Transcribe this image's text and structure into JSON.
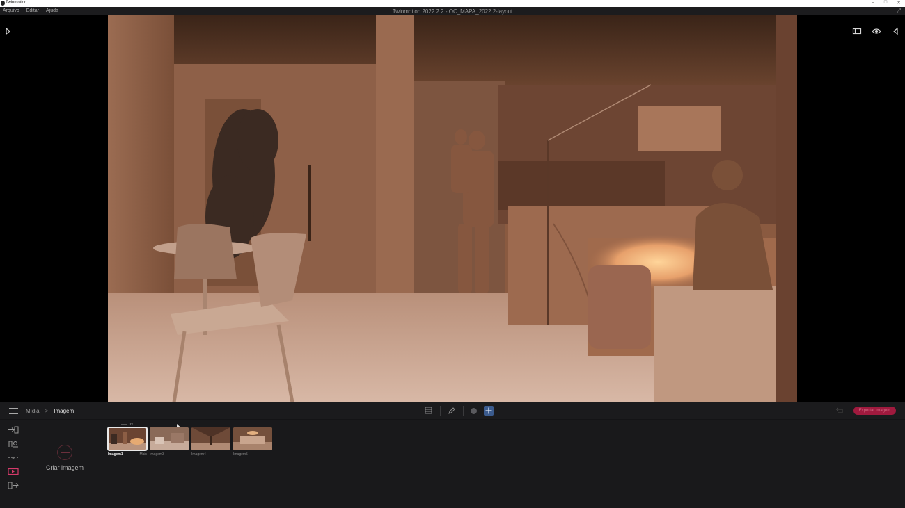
{
  "window": {
    "app_name": "Twinmotion",
    "doc_title": "Twinmotion 2022.2.2 - OC_MAPA_2022.2-layout",
    "controls": [
      "–",
      "□",
      "✕"
    ]
  },
  "menu": [
    "Arquivo",
    "Editar",
    "Ajuda"
  ],
  "breadcrumb": {
    "parent": "Mídia",
    "separator": ">",
    "current": "Imagem"
  },
  "toolbar": {
    "export_label": "Exportar imagem"
  },
  "create_image": {
    "label": "Criar imagem"
  },
  "thumbnails": [
    {
      "name": "Imagem1",
      "selected": true,
      "more": "Mais"
    },
    {
      "name": "Imagem3",
      "selected": false
    },
    {
      "name": "Imagem4",
      "selected": false
    },
    {
      "name": "Imagem5",
      "selected": false
    }
  ],
  "colors": {
    "accent_red": "#a01a3e",
    "move_active": "#3b5b8e",
    "panel_bg": "#19191b"
  },
  "icons": {
    "left_panel_toggle": "play-triangle-icon",
    "top_right": [
      "layout-icon",
      "eye-icon",
      "collapse-left-icon"
    ],
    "left_rail": [
      "import-icon",
      "context-icon",
      "configuration-icon",
      "media-icon",
      "export-icon"
    ],
    "center_tools": [
      "layers-icon",
      "pen-icon",
      "sphere-icon",
      "move-icon"
    ]
  }
}
